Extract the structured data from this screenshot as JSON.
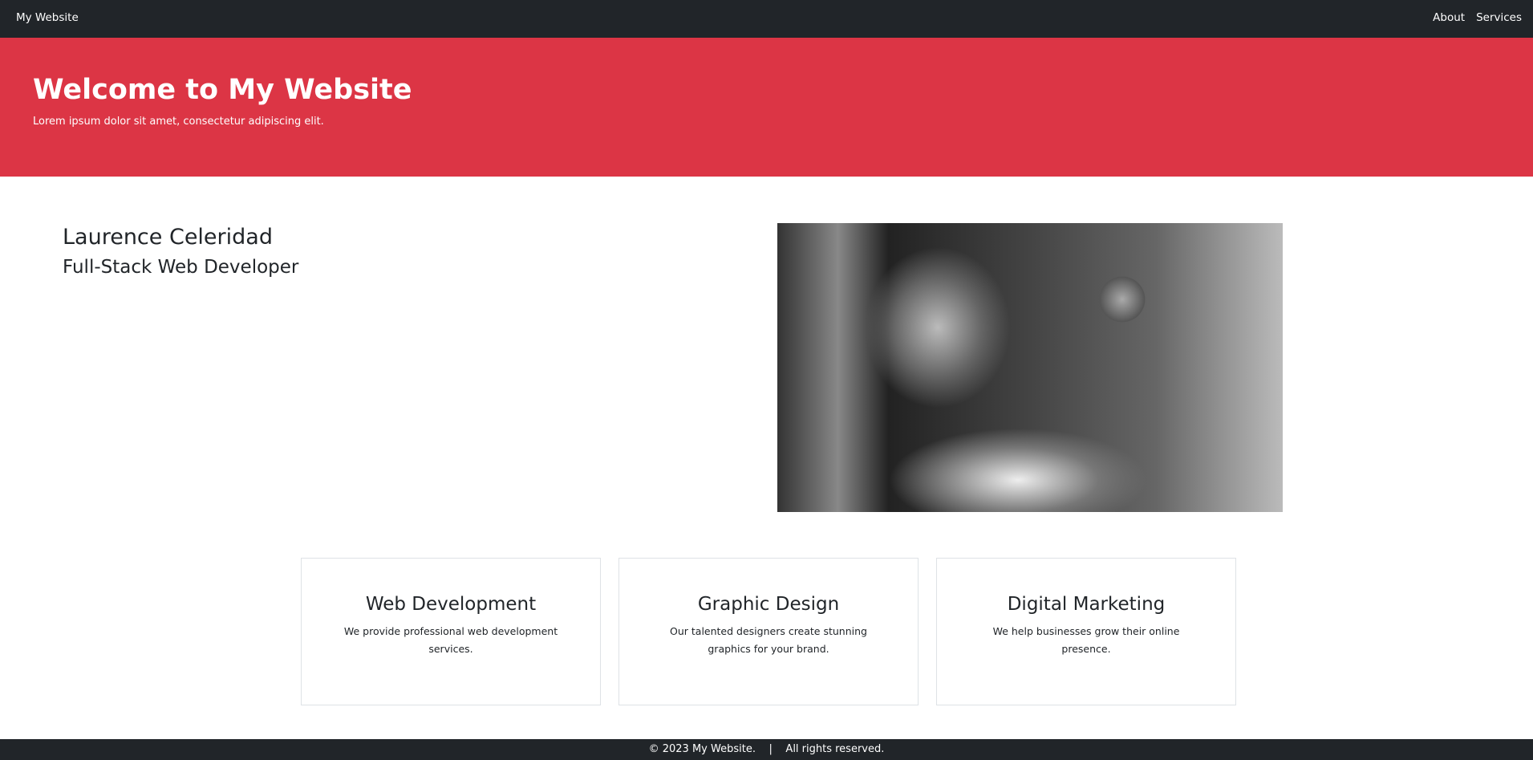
{
  "navbar": {
    "brand": "My Website",
    "links": [
      "About",
      "Services"
    ]
  },
  "hero": {
    "title": "Welcome to My Website",
    "subtitle": "Lorem ipsum dolor sit amet, consectetur adipiscing elit.",
    "background": "#dc3545"
  },
  "profile": {
    "name": "Laurence Celeridad",
    "role": "Full-Stack Web Developer",
    "image": "kitten-photo-grayscale"
  },
  "services": [
    {
      "title": "Web Development",
      "text": "We provide professional web development services."
    },
    {
      "title": "Graphic Design",
      "text": "Our talented designers create stunning graphics for your brand."
    },
    {
      "title": "Digital Marketing",
      "text": "We help businesses grow their online presence."
    }
  ],
  "footer": {
    "copyright": "© 2023 My Website.",
    "separator": "|",
    "rights": "All rights reserved."
  }
}
